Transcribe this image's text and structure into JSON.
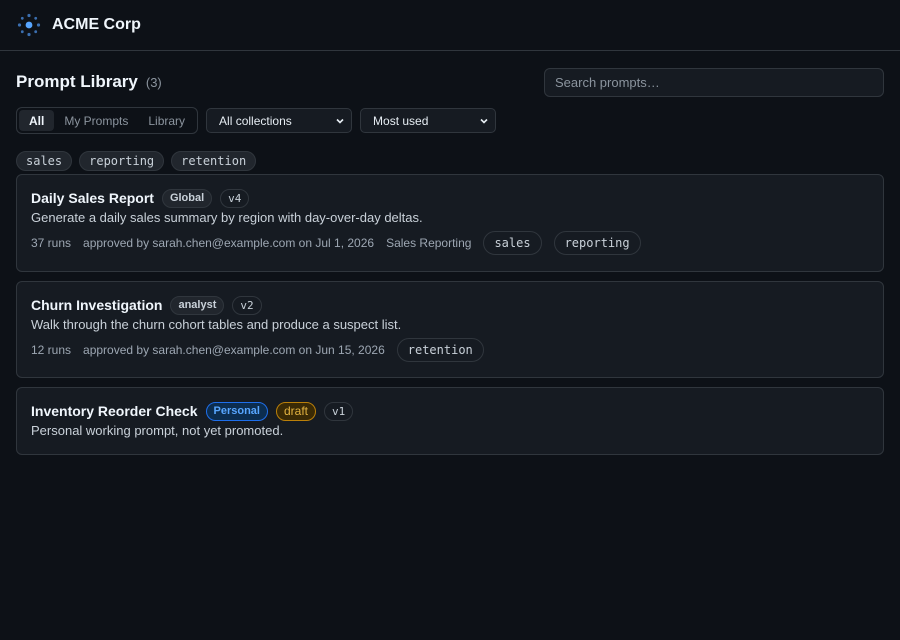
{
  "app": {
    "brand": "ACME Corp",
    "logo_icon": "network-hub-icon"
  },
  "page": {
    "title": "Prompt Library",
    "count": "(3)"
  },
  "search": {
    "placeholder": "Search prompts…",
    "value": ""
  },
  "filters": {
    "scope_tabs": [
      {
        "label": "All",
        "active": true
      },
      {
        "label": "My Prompts",
        "active": false
      },
      {
        "label": "Library",
        "active": false
      }
    ],
    "collection": {
      "selected": "All collections"
    },
    "sort": {
      "selected": "Most used"
    }
  },
  "tag_filters": [
    "sales",
    "reporting",
    "retention"
  ],
  "prompts": [
    {
      "title": "Daily Sales Report",
      "badges": [
        "Global",
        "v4"
      ],
      "description": "Generate a daily sales summary by region with day-over-day deltas.",
      "runs": "37 runs",
      "approved": "approved by sarah.chen@example.com on Jul 1, 2026",
      "collection": "Sales Reporting",
      "tags": [
        "sales",
        "reporting"
      ]
    },
    {
      "title": "Churn Investigation",
      "badges": [
        "analyst",
        "v2"
      ],
      "description": "Walk through the churn cohort tables and produce a suspect list.",
      "runs": "12 runs",
      "approved": "approved by sarah.chen@example.com on Jun 15, 2026",
      "tags": [
        "retention"
      ]
    },
    {
      "title": "Inventory Reorder Check",
      "badges": [
        "Personal",
        "draft",
        "v1"
      ],
      "description": "Personal working prompt, not yet promoted."
    }
  ],
  "colors": {
    "background": "#0d1117",
    "surface": "#161b22",
    "border": "#30363d",
    "personal_badge": "#58a6ff",
    "draft_badge": "#e3b341"
  }
}
